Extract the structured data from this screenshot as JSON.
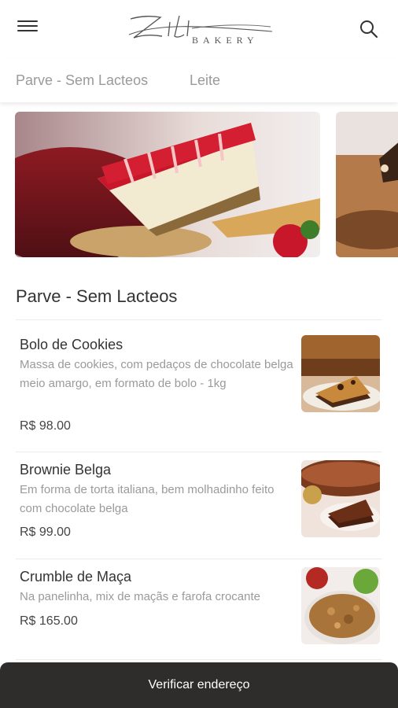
{
  "header": {
    "logo_script": "Zili",
    "logo_tagline": "BAKERY"
  },
  "tabs": [
    {
      "label": "Parve - Sem Lacteos"
    },
    {
      "label": "Leite"
    }
  ],
  "section": {
    "title": "Parve - Sem Lacteos"
  },
  "products": [
    {
      "name": "Bolo de Cookies",
      "description": "Massa de cookies, com pedaços de chocolate belga meio amargo, em formato de bolo - 1kg",
      "price": "R$ 98.00"
    },
    {
      "name": "Brownie Belga",
      "description": "Em forma de torta italiana, bem molhadinho feito com chocolate belga",
      "price": "R$ 99.00"
    },
    {
      "name": "Crumble de Maça",
      "description": "Na panelinha, mix de maçãs e farofa crocante",
      "price": "R$ 165.00"
    }
  ],
  "bottom_bar": {
    "label": "Verificar endereço"
  },
  "colors": {
    "bottom_bar": "#2f2c2c",
    "tab_text": "#9a9a9a",
    "text_primary": "#333333"
  },
  "icons": [
    "menu-icon",
    "search-icon"
  ]
}
